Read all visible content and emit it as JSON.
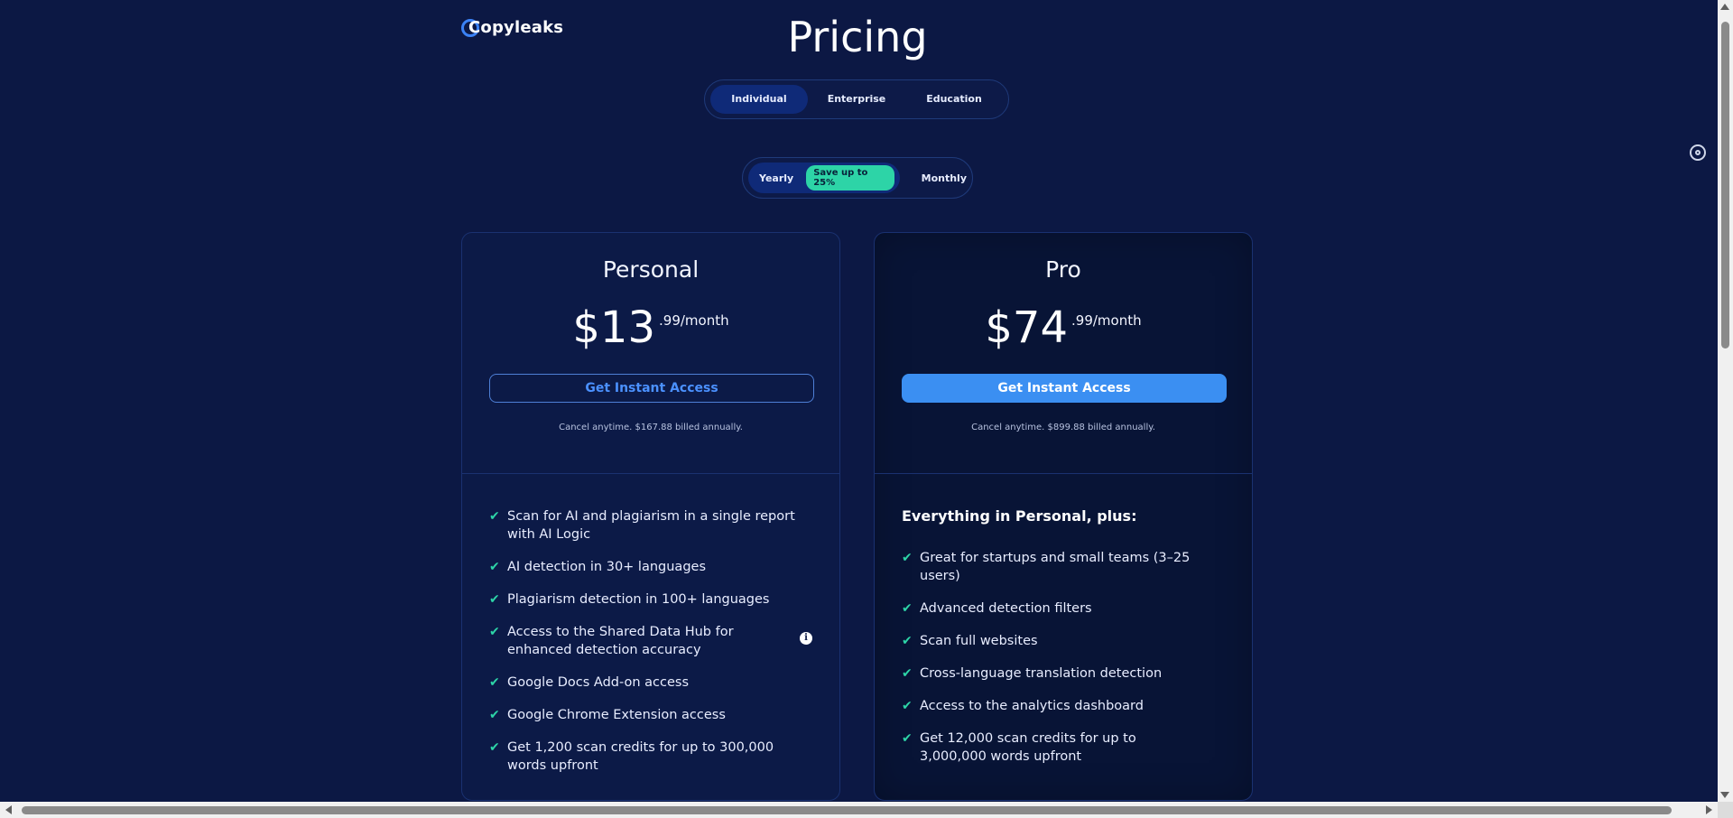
{
  "brand": {
    "name": "Copyleaks"
  },
  "page": {
    "title": "Pricing"
  },
  "segments": [
    {
      "label": "Individual",
      "active": true
    },
    {
      "label": "Enterprise",
      "active": false
    },
    {
      "label": "Education",
      "active": false
    }
  ],
  "billing": {
    "yearly": "Yearly",
    "save_badge": "Save up to 25%",
    "monthly": "Monthly",
    "selected": "Yearly"
  },
  "plans": [
    {
      "name": "Personal",
      "price_main": "$13",
      "price_sub": ".99/month",
      "cta": "Get Instant Access",
      "cancel_note": "Cancel anytime. $167.88 billed annually.",
      "features": [
        "Scan for AI and plagiarism in a single report with AI Logic",
        "AI detection in 30+ languages",
        "Plagiarism detection in 100+ languages",
        "Access to the Shared Data Hub for enhanced detection accuracy",
        "Google Docs Add-on access",
        "Google Chrome Extension access",
        "Get 1,200 scan credits for up to 300,000 words upfront"
      ]
    },
    {
      "name": "Pro",
      "price_main": "$74",
      "price_sub": ".99/month",
      "cta": "Get Instant Access",
      "cancel_note": "Cancel anytime. $899.88 billed annually.",
      "plus_heading": "Everything in Personal, plus:",
      "features": [
        "Great for startups and small teams (3–25 users)",
        "Advanced detection filters",
        "Scan full websites",
        "Cross-language translation detection",
        "Access to the analytics dashboard",
        "Get 12,000 scan credits for up to 3,000,000 words upfront"
      ]
    }
  ],
  "icons": {
    "check": "check-icon",
    "info": "info-icon",
    "side": "target-icon"
  },
  "colors": {
    "background": "#0c1844",
    "accent_blue": "#3b8ff2",
    "check_green": "#2dd4a7"
  }
}
